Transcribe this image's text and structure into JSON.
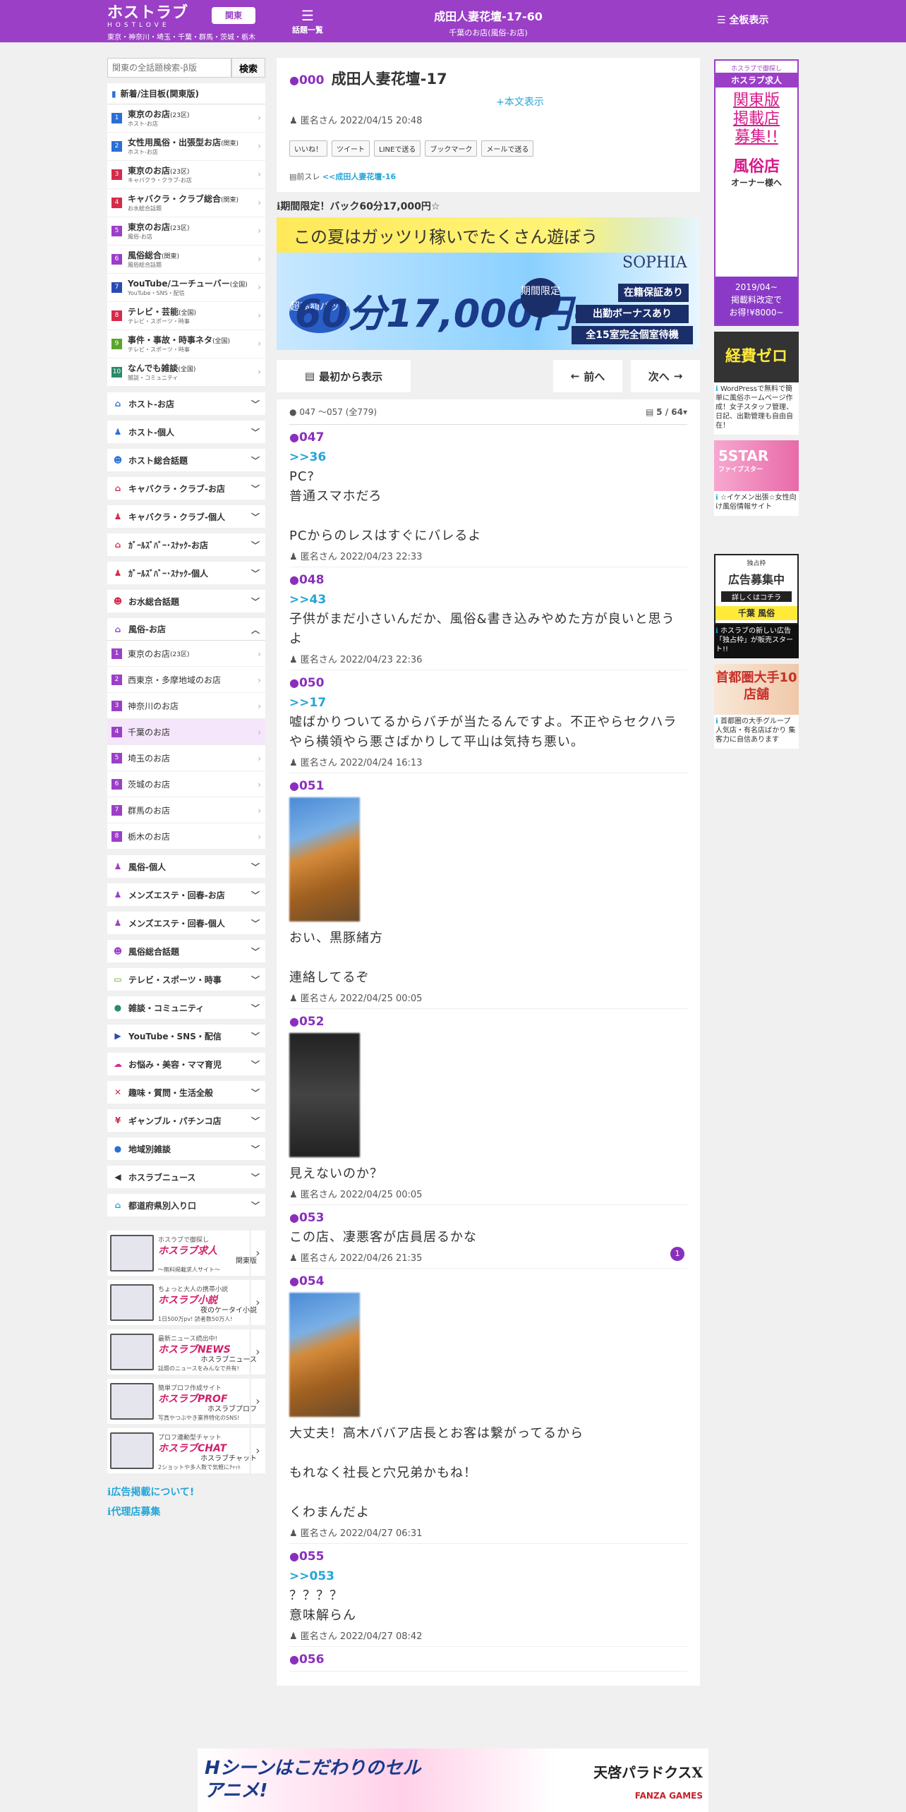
{
  "header": {
    "logo_main": "ホストラブ",
    "logo_sub": "HOSTLOVE",
    "area_line": "東京・神奈川・埼玉・千葉・群馬・茨城・栃木",
    "region_button": "関東",
    "topics_label": "話題一覧",
    "title": "成田人妻花壇-17-60",
    "subtitle": "千葉のお店(風俗-お店)",
    "all_boards": "全板表示"
  },
  "search": {
    "placeholder": "関東の全話題検索-β版",
    "button": "検索"
  },
  "new_boards": {
    "heading": "新着/注目板(関東版)",
    "items": [
      {
        "n": "1",
        "label": "東京のお店",
        "suffix": "(23区)",
        "sub": "ホスト-お店",
        "color": "#2a6fd6"
      },
      {
        "n": "2",
        "label": "女性用風俗・出張型お店",
        "suffix": "(関東)",
        "sub": "ホスト-お店",
        "color": "#2a6fd6"
      },
      {
        "n": "3",
        "label": "東京のお店",
        "suffix": "(23区)",
        "sub": "キャバクラ・クラブ-お店",
        "color": "#d62a4a"
      },
      {
        "n": "4",
        "label": "キャバクラ・クラブ総合",
        "suffix": "(関東)",
        "sub": "お水総合話題",
        "color": "#d62a4a"
      },
      {
        "n": "5",
        "label": "東京のお店",
        "suffix": "(23区)",
        "sub": "風俗-お店",
        "color": "#9b3fc7"
      },
      {
        "n": "6",
        "label": "風俗総合",
        "suffix": "(関東)",
        "sub": "風俗総合話題",
        "color": "#9b3fc7"
      },
      {
        "n": "7",
        "label": "YouTube/ユーチューバー",
        "suffix": "(全国)",
        "sub": "YouTube・SNS・配信",
        "color": "#2a4ab6"
      },
      {
        "n": "8",
        "label": "テレビ・芸能",
        "suffix": "(全国)",
        "sub": "テレビ・スポーツ・時事",
        "color": "#d62a4a"
      },
      {
        "n": "9",
        "label": "事件・事故・時事ネタ",
        "suffix": "(全国)",
        "sub": "テレビ・スポーツ・時事",
        "color": "#5aa52a"
      },
      {
        "n": "10",
        "label": "なんでも雑談",
        "suffix": "(全国)",
        "sub": "雑談・コミュニティ",
        "color": "#2a8a6a"
      }
    ]
  },
  "categories_top": [
    {
      "label": "ホスト-お店",
      "icon": "home-icon",
      "glyph": "⌂",
      "color": "#2a6fd6"
    },
    {
      "label": "ホスト-個人",
      "icon": "person-icon",
      "glyph": "♟",
      "color": "#2a6fd6"
    },
    {
      "label": "ホスト総合話題",
      "icon": "group-icon",
      "glyph": "☻",
      "color": "#2a6fd6"
    },
    {
      "label": "キャバクラ・クラブ-お店",
      "icon": "home-icon",
      "glyph": "⌂",
      "color": "#d62a4a"
    },
    {
      "label": "キャバクラ・クラブ-個人",
      "icon": "person-icon",
      "glyph": "♟",
      "color": "#d62a4a"
    },
    {
      "label": "ｶﾞｰﾙｽﾞﾊﾞｰ･ｽﾅｯｸ-お店",
      "icon": "home-icon",
      "glyph": "⌂",
      "color": "#d62a4a"
    },
    {
      "label": "ｶﾞｰﾙｽﾞﾊﾞｰ･ｽﾅｯｸ-個人",
      "icon": "person-icon",
      "glyph": "♟",
      "color": "#d62a4a"
    },
    {
      "label": "お水総合話題",
      "icon": "group-icon",
      "glyph": "☻",
      "color": "#d62a4a"
    }
  ],
  "fuzoku": {
    "heading": "風俗-お店",
    "items": [
      "東京のお店",
      "西東京・多摩地域のお店",
      "神奈川のお店",
      "千葉のお店",
      "埼玉のお店",
      "茨城のお店",
      "群馬のお店",
      "栃木のお店"
    ],
    "suffix0": "(23区)"
  },
  "categories_bottom": [
    {
      "label": "風俗-個人",
      "icon": "person-icon",
      "glyph": "♟",
      "color": "#9b3fc7"
    },
    {
      "label": "メンズエステ・回春-お店",
      "icon": "person-icon",
      "glyph": "♟",
      "color": "#9b3fc7"
    },
    {
      "label": "メンズエステ・回春-個人",
      "icon": "person-icon",
      "glyph": "♟",
      "color": "#9b3fc7"
    },
    {
      "label": "風俗総合話題",
      "icon": "group-icon",
      "glyph": "☻",
      "color": "#9b3fc7"
    },
    {
      "label": "テレビ・スポーツ・時事",
      "icon": "tv-icon",
      "glyph": "▭",
      "color": "#5aa52a"
    },
    {
      "label": "雑談・コミュニティ",
      "icon": "chat-icon",
      "glyph": "●",
      "color": "#2a8a6a"
    },
    {
      "label": "YouTube・SNS・配信",
      "icon": "youtube-icon",
      "glyph": "▶",
      "color": "#2a4ab6"
    },
    {
      "label": "お悩み・美容・ママ育児",
      "icon": "cloud-icon",
      "glyph": "☁",
      "color": "#d62a9a"
    },
    {
      "label": "趣味・質問・生活全般",
      "icon": "fork-icon",
      "glyph": "✕",
      "color": "#d62a4a"
    },
    {
      "label": "ギャンブル・パチンコ店",
      "icon": "money-icon",
      "glyph": "¥",
      "color": "#d62a4a"
    },
    {
      "label": "地域別雑談",
      "icon": "chat-icon",
      "glyph": "●",
      "color": "#2a6fd6"
    },
    {
      "label": "ホスラブニュース",
      "icon": "speaker-icon",
      "glyph": "◀",
      "color": "#333333"
    },
    {
      "label": "都道府県別入り口",
      "icon": "home-icon",
      "glyph": "⌂",
      "color": "#25a5d8"
    }
  ],
  "banners": [
    {
      "t1": "ホスラブで御探し",
      "t2": "ホスラブ求人",
      "t3": "関東版",
      "t4": "〜無料掲載求人サイト〜"
    },
    {
      "t1": "ちょっと大人の携帯小説",
      "t2": "ホスラブ小説",
      "t3": "夜のケータイ小説",
      "t4": "1日500万pv! 読者数50万人!"
    },
    {
      "t1": "最新ニュース続出中!",
      "t2": "ホスラブNEWS",
      "t3": "ホスラブニュース",
      "t4": "話題のニュースをみんなで共有!"
    },
    {
      "t1": "簡単プロフ作成サイト",
      "t2": "ホスラブPROF",
      "t3": "ホスラブプロフ",
      "t4": "写真やつぶやき業界特化のSNS!"
    },
    {
      "t1": "プロフ連動型チャット",
      "t2": "ホスラブCHAT",
      "t3": "ホスラブチャット",
      "t4": "2ショットや多人数で気軽にﾁｬｯﾄ"
    }
  ],
  "side_links": [
    "広告掲載について!",
    "代理店募集"
  ],
  "thread": {
    "id": "000",
    "title": "成田人妻花壇-17",
    "more": "+本文表示",
    "meta": "匿名さん 2022/04/15 20:48",
    "share": [
      "いいね！",
      "ツイート",
      "LINEで送る",
      "ブックマーク",
      "メールで送る"
    ],
    "prev_label": "前スレ",
    "prev_link": "<<成田人妻花壇-16"
  },
  "promo": {
    "label": "期間限定！バック60分17,000円☆",
    "line1": "この夏はガッツリ稼いでたくさん遊ぼう",
    "brand": "SOPHIA",
    "badge": "超高額バック",
    "big": "60分17,000円~",
    "period": "期間限定",
    "bar1": "在籍保証あり",
    "bar2": "出勤ボーナスあり",
    "bar3": "全15室完全個室待機"
  },
  "nav": {
    "first": "最初から表示",
    "prev": "前へ",
    "next": "次へ"
  },
  "range": {
    "text": "047 ～057 (全779)",
    "page": "5 / 64"
  },
  "posts": [
    {
      "no": "047",
      "ref": ">>36",
      "text": "PC?\n普通スマホだろ\n\nPCからのレスはすぐにバレるよ",
      "by": "匿名さん 2022/04/23 22:33"
    },
    {
      "no": "048",
      "ref": ">>43",
      "text": "子供がまだ小さいんだか、風俗&書き込みやめた方が良いと思うよ",
      "by": "匿名さん 2022/04/23 22:36"
    },
    {
      "no": "050",
      "ref": ">>17",
      "text": "嘘ばかりついてるからバチが当たるんですよ。不正やらセクハラやら横領やら悪さばかりして平山は気持ち悪い。",
      "by": "匿名さん 2022/04/24 16:13"
    },
    {
      "no": "051",
      "ref": "",
      "text": "おい、黒豚緒方\n\n連絡してるぞ",
      "by": "匿名さん 2022/04/25 00:05",
      "pic": "photo"
    },
    {
      "no": "052",
      "ref": "",
      "text": "見えないのか？",
      "by": "匿名さん 2022/04/25 00:05",
      "pic": "dark"
    },
    {
      "no": "053",
      "ref": "",
      "text": "この店、凄悪客が店員居るかな",
      "by": "匿名さん 2022/04/26 21:35",
      "badge": "1"
    },
    {
      "no": "054",
      "ref": "",
      "text": "大丈夫！高木ババア店長とお客は繋がってるから\n\nもれなく社長と穴兄弟かもね！\n\nくわまんだよ",
      "by": "匿名さん 2022/04/27 06:31",
      "pic": "photo"
    },
    {
      "no": "055",
      "ref": ">>053",
      "text": "？？？？\n意味解らん",
      "by": "匿名さん 2022/04/27 08:42"
    },
    {
      "no": "056",
      "ref": "",
      "text": "",
      "by": ""
    }
  ],
  "right_ads": {
    "a1": {
      "t1": "ホスラブで御探し",
      "t2": "ホスラブ求人",
      "t3": "関東版\n掲載店\n募集!!",
      "t4": "風俗店",
      "t5": "オーナー様へ",
      "t6": "2019/04~\n掲載料改定で\nお得!¥8000~"
    },
    "a2": {
      "t1": "経費ゼロ",
      "cap": "WordPressで無料で簡単に風俗ホームページ作成！女子スタッフ管理、日記、出勤管理も自由自在！"
    },
    "a3": {
      "t1": "5STAR",
      "t2": "ファイブスター",
      "cap": "☆イケメン出張☆女性向け風俗情報サイト"
    },
    "a4": {
      "t1": "独占枠",
      "t2": "広告募集中",
      "t3": "詳しくはコチラ",
      "t4": "千葉 風俗",
      "cap": "ホスラブの新しい広告「独占枠」が販売スタート!!"
    },
    "a5": {
      "t1": "首都圏大手10店舗",
      "cap": "首都圏の大手グループ 人気店・有名店ばかり 集客力に自信あります"
    }
  },
  "bottom_ad": {
    "left": "Hシーンはこだわりのセルアニメ!",
    "right": "天啓パラドクスX",
    "brand": "FANZA GAMES"
  }
}
